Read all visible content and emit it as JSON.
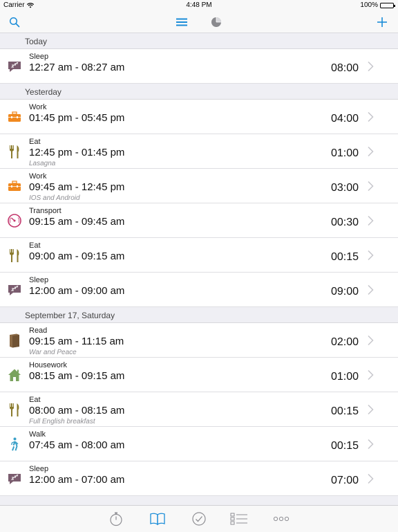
{
  "status": {
    "carrier": "Carrier",
    "time": "4:48 PM",
    "battery": "100%"
  },
  "nav": {
    "icons": [
      "search-icon",
      "list-icon",
      "pie-chart-icon",
      "plus-icon"
    ]
  },
  "sections": [
    {
      "header": "Today",
      "rows": [
        {
          "category": "Sleep",
          "range": "12:27 am - 08:27 am",
          "note": "",
          "duration": "08:00",
          "icon": "sleep-icon"
        }
      ]
    },
    {
      "header": "Yesterday",
      "rows": [
        {
          "category": "Work",
          "range": "01:45 pm - 05:45 pm",
          "note": "",
          "duration": "04:00",
          "icon": "work-icon"
        },
        {
          "category": "Eat",
          "range": "12:45 pm - 01:45 pm",
          "note": "Lasagna",
          "duration": "01:00",
          "icon": "eat-icon"
        },
        {
          "category": "Work",
          "range": "09:45 am - 12:45 pm",
          "note": "IOS and Android",
          "duration": "03:00",
          "icon": "work-icon"
        },
        {
          "category": "Transport",
          "range": "09:15 am - 09:45 am",
          "note": "",
          "duration": "00:30",
          "icon": "transport-icon"
        },
        {
          "category": "Eat",
          "range": "09:00 am - 09:15 am",
          "note": "",
          "duration": "00:15",
          "icon": "eat-icon"
        },
        {
          "category": "Sleep",
          "range": "12:00 am - 09:00 am",
          "note": "",
          "duration": "09:00",
          "icon": "sleep-icon"
        }
      ]
    },
    {
      "header": "September 17, Saturday",
      "rows": [
        {
          "category": "Read",
          "range": "09:15 am - 11:15 am",
          "note": "War and Peace",
          "duration": "02:00",
          "icon": "read-icon"
        },
        {
          "category": "Housework",
          "range": "08:15 am - 09:15 am",
          "note": "",
          "duration": "01:00",
          "icon": "housework-icon"
        },
        {
          "category": "Eat",
          "range": "08:00 am - 08:15 am",
          "note": "Full English breakfast",
          "duration": "00:15",
          "icon": "eat-icon"
        },
        {
          "category": "Walk",
          "range": "07:45 am - 08:00 am",
          "note": "",
          "duration": "00:15",
          "icon": "walk-icon"
        },
        {
          "category": "Sleep",
          "range": "12:00 am - 07:00 am",
          "note": "",
          "duration": "07:00",
          "icon": "sleep-icon"
        }
      ]
    }
  ],
  "tabs": [
    "stopwatch-icon",
    "log-book-icon",
    "check-icon",
    "checklist-icon",
    "more-icon"
  ],
  "colors": {
    "accent": "#1a8cd8",
    "sleep": "#7a5c6e",
    "work": "#f0891f",
    "eat": "#8a7a2c",
    "transport": "#c2356b",
    "read": "#8b6a45",
    "housework": "#7aa35e",
    "walk": "#3aa0c8"
  }
}
